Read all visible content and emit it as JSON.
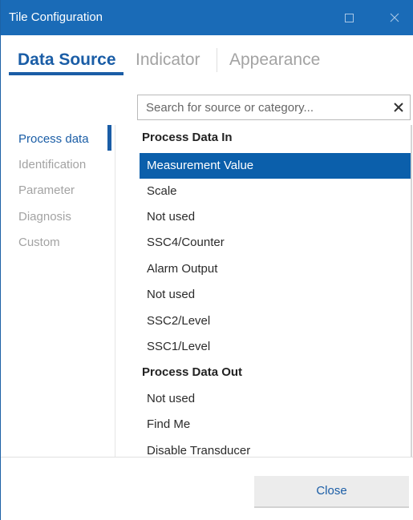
{
  "window": {
    "title": "Tile Configuration"
  },
  "tabs": [
    {
      "label": "Data Source",
      "active": true
    },
    {
      "label": "Indicator",
      "active": false
    },
    {
      "label": "Appearance",
      "active": false
    }
  ],
  "search": {
    "placeholder": "Search for source or category...",
    "value": ""
  },
  "categories": [
    {
      "label": "Process data",
      "active": true
    },
    {
      "label": "Identification",
      "active": false
    },
    {
      "label": "Parameter",
      "active": false
    },
    {
      "label": "Diagnosis",
      "active": false
    },
    {
      "label": "Custom",
      "active": false
    }
  ],
  "sources": [
    {
      "label": "Process Data In",
      "type": "header"
    },
    {
      "label": "Measurement Value",
      "type": "item",
      "selected": true
    },
    {
      "label": "Scale",
      "type": "item"
    },
    {
      "label": "Not used",
      "type": "item"
    },
    {
      "label": "SSC4/Counter",
      "type": "item"
    },
    {
      "label": "Alarm Output",
      "type": "item"
    },
    {
      "label": "Not used",
      "type": "item"
    },
    {
      "label": "SSC2/Level",
      "type": "item"
    },
    {
      "label": "SSC1/Level",
      "type": "item"
    },
    {
      "label": "Process Data Out",
      "type": "header"
    },
    {
      "label": "Not used",
      "type": "item"
    },
    {
      "label": "Find Me",
      "type": "item"
    },
    {
      "label": "Disable Transducer",
      "type": "item"
    }
  ],
  "footer": {
    "close_label": "Close"
  },
  "colors": {
    "titlebar": "#1a6bb7",
    "accent": "#1a5da6",
    "selection": "#0b5fab",
    "inactive_text": "#a3a3a3"
  },
  "icons": {
    "maximize": "maximize-icon",
    "close": "close-icon",
    "clear": "clear-search-icon"
  }
}
